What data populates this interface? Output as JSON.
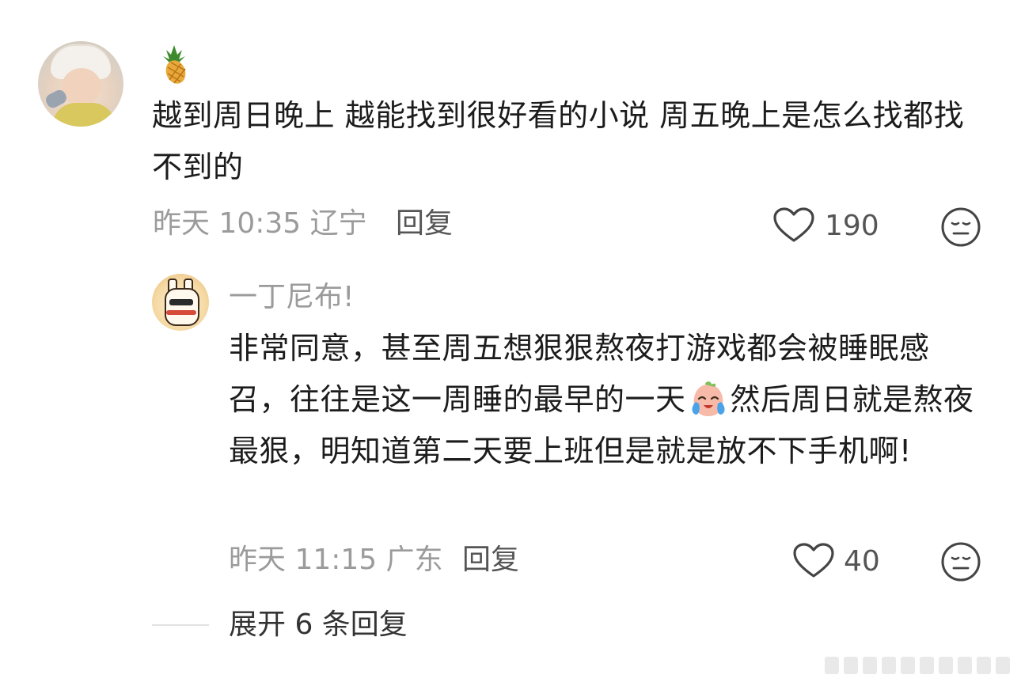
{
  "comment": {
    "text": "越到周日晚上 越能找到很好看的小说 周五晚上是怎么找都找不到的",
    "meta": "昨天 10:35 辽宁",
    "reply_label": "回复",
    "like_count": "190"
  },
  "reply": {
    "username": "一丁尼布!",
    "text_part1": "非常同意，甚至周五想狠狠熬夜打游戏都会被睡眠感召，往往是这一周睡的最早的一天",
    "text_part2": "然后周日就是熬夜最狠，明知道第二天要上班但是就是放不下手机啊!",
    "meta": "昨天 11:15 广东",
    "reply_label": "回复",
    "like_count": "40"
  },
  "expand": {
    "label": "展开 6 条回复"
  },
  "icons": {
    "like": "heart-outline-icon",
    "dislike": "meh-face-icon",
    "emoji_main": "pineapple-emoji",
    "emoji_reply": "crying-face-emoji"
  },
  "colors": {
    "text": "#1c1c1c",
    "meta": "#9b9b9b",
    "icon": "#444444"
  }
}
